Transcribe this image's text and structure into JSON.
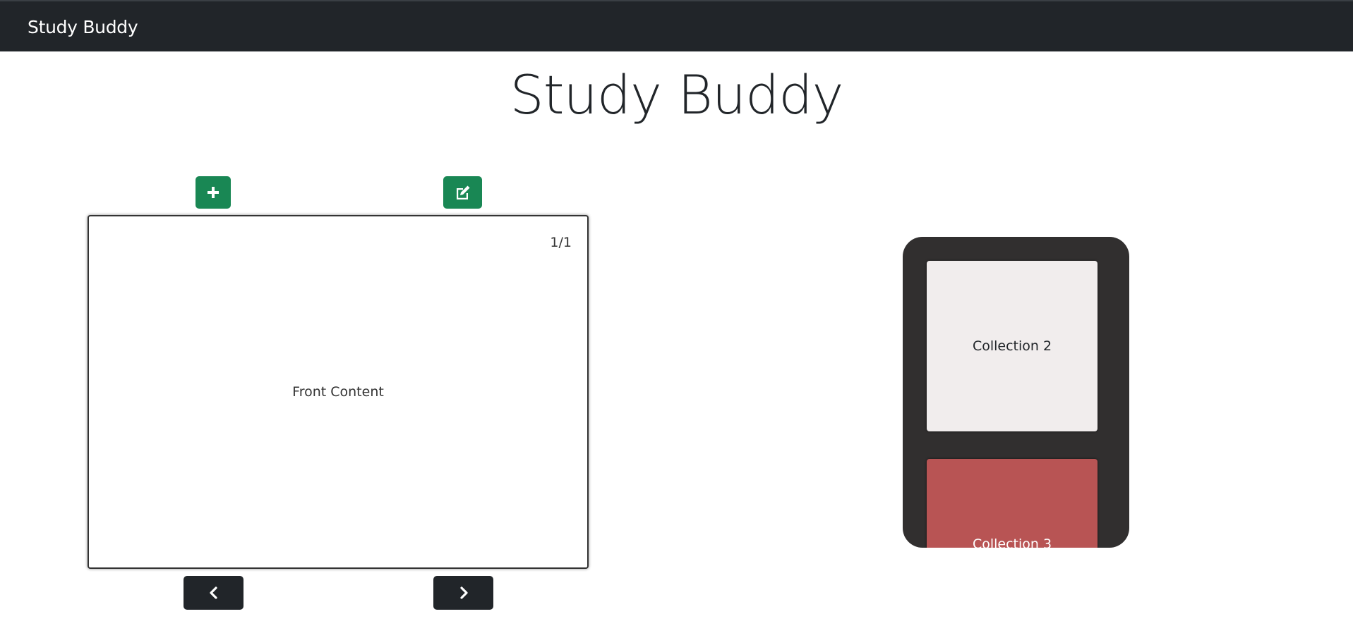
{
  "navbar": {
    "brand": "Study Buddy"
  },
  "header": {
    "title": "Study Buddy"
  },
  "toolbar": {
    "add_icon": "plus-icon",
    "edit_icon": "edit-icon"
  },
  "card": {
    "counter": "1/1",
    "content": "Front Content"
  },
  "nav_buttons": {
    "prev_icon": "chevron-left-icon",
    "next_icon": "chevron-right-icon"
  },
  "collections": [
    {
      "label": "Collection 2",
      "color": "#f1eded"
    },
    {
      "label": "Collection 3",
      "color": "#b85454"
    }
  ],
  "colors": {
    "accent_green": "#198754",
    "dark": "#212529",
    "collections_bg": "#312f2f"
  }
}
